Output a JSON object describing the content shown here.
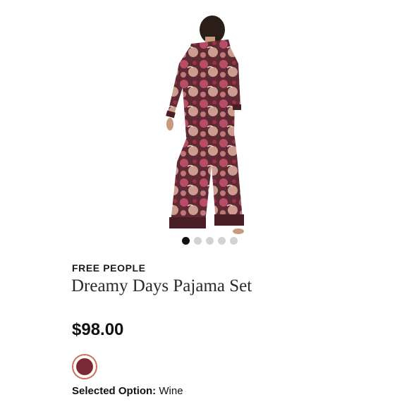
{
  "product": {
    "brand": "FREE PEOPLE",
    "name": "Dreamy Days Pajama Set",
    "price": "$98.00",
    "selected_option_label": "Selected Option:",
    "selected_option_value": "Wine",
    "swatch_color": "#7b2a35",
    "swatch_ring_color": "#d46a5b"
  },
  "carousel": {
    "total_images": 5,
    "active_index": 0
  }
}
